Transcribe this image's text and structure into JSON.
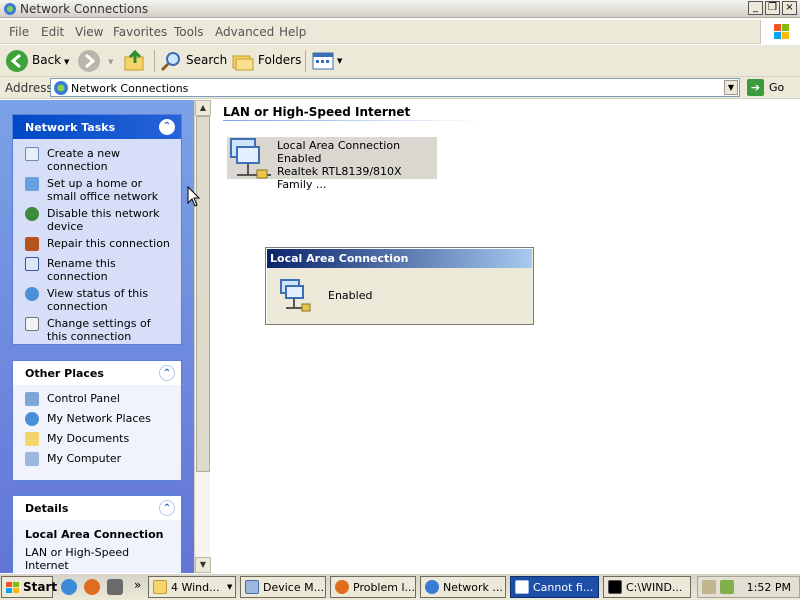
{
  "window": {
    "title": "Network Connections",
    "controls": [
      "_",
      "⧉",
      "×"
    ]
  },
  "menu": {
    "items": [
      "File",
      "Edit",
      "View",
      "Favorites",
      "Tools",
      "Advanced",
      "Help"
    ]
  },
  "toolbar": {
    "back_label": "Back",
    "search_label": "Search",
    "folders_label": "Folders"
  },
  "address": {
    "label": "Address",
    "value": "Network Connections",
    "go_label": "Go"
  },
  "sidebar": {
    "network_tasks": {
      "title": "Network Tasks",
      "items": [
        {
          "label": "Create a new connection",
          "icon": "new-connection-icon"
        },
        {
          "label": "Set up a home or small office network",
          "icon": "home-network-icon"
        },
        {
          "label": "Disable this network device",
          "icon": "disable-device-icon"
        },
        {
          "label": "Repair this connection",
          "icon": "repair-icon"
        },
        {
          "label": "Rename this connection",
          "icon": "rename-icon"
        },
        {
          "label": "View status of this connection",
          "icon": "status-icon"
        },
        {
          "label": "Change settings of this connection",
          "icon": "settings-icon"
        }
      ]
    },
    "other_places": {
      "title": "Other Places",
      "items": [
        {
          "label": "Control Panel",
          "icon": "control-panel-icon"
        },
        {
          "label": "My Network Places",
          "icon": "network-places-icon"
        },
        {
          "label": "My Documents",
          "icon": "documents-icon"
        },
        {
          "label": "My Computer",
          "icon": "computer-icon"
        }
      ]
    },
    "details": {
      "title": "Details",
      "name": "Local Area Connection",
      "type": "LAN or High-Speed Internet"
    }
  },
  "main": {
    "group_heading": "LAN or High-Speed Internet",
    "connection": {
      "name": "Local Area Connection",
      "status": "Enabled",
      "device": "Realtek RTL8139/810X Family ..."
    }
  },
  "popup": {
    "title": "Local Area Connection",
    "status": "Enabled"
  },
  "taskbar": {
    "start_label": "Start",
    "buttons": [
      {
        "label": "4 Wind...",
        "icon": "folder-icon"
      },
      {
        "label": "Device M...",
        "icon": "device-manager-icon"
      },
      {
        "label": "Problem l...",
        "icon": "firefox-icon"
      },
      {
        "label": "Network ...",
        "icon": "network-icon"
      },
      {
        "label": "Cannot fi...",
        "icon": "window-icon"
      },
      {
        "label": "C:\\WIND...",
        "icon": "cmd-icon"
      }
    ],
    "clock": "1:52 PM"
  }
}
